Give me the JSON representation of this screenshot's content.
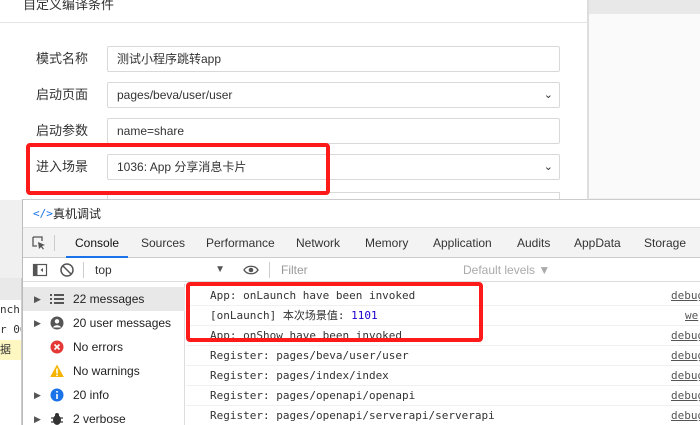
{
  "dialog": {
    "title": "自定义编译条件",
    "fields": [
      {
        "label": "模式名称",
        "value": "测试小程序跳转app",
        "dropdown": false
      },
      {
        "label": "启动页面",
        "value": "pages/beva/user/user",
        "dropdown": true
      },
      {
        "label": "启动参数",
        "value": "name=share",
        "dropdown": false
      },
      {
        "label": "进入场景",
        "value": "1036: App 分享消息卡片",
        "dropdown": true
      }
    ],
    "cut_label": "编",
    "cut_value": ""
  },
  "background": {
    "code_lines": [
      "nch]",
      "r 06",
      "据"
    ]
  },
  "devtools": {
    "title": "真机调试",
    "tabs": [
      "Console",
      "Sources",
      "Performance",
      "Network",
      "Memory",
      "Application",
      "Audits",
      "AppData",
      "Storage"
    ],
    "active_tab": "Console",
    "context": "top",
    "filter_placeholder": "Filter",
    "levels": "Default levels ▼",
    "sidebar": [
      {
        "label": "22 messages",
        "icon": "list-icon",
        "expandable": true,
        "selected": true
      },
      {
        "label": "20 user messages",
        "icon": "user-icon",
        "expandable": true,
        "selected": false
      },
      {
        "label": "No errors",
        "icon": "error-icon",
        "expandable": false,
        "selected": false
      },
      {
        "label": "No warnings",
        "icon": "warning-icon",
        "expandable": false,
        "selected": false
      },
      {
        "label": "20 info",
        "icon": "info-icon",
        "expandable": true,
        "selected": false
      },
      {
        "label": "2 verbose",
        "icon": "verbose-icon",
        "expandable": true,
        "selected": false
      }
    ],
    "logs": [
      {
        "text": "App: onLaunch have been invoked",
        "source": "debug"
      },
      {
        "text": "[onLaunch] 本次场景值:",
        "number": "1101",
        "source": "we"
      },
      {
        "text": "App: onShow have been invoked",
        "source": "debug"
      },
      {
        "text": "Register: pages/beva/user/user",
        "source": "debug"
      },
      {
        "text": "Register: pages/index/index",
        "source": "debug"
      },
      {
        "text": "Register: pages/openapi/openapi",
        "source": "debug"
      },
      {
        "text": "Register: pages/openapi/serverapi/serverapi",
        "source": "debug"
      }
    ]
  },
  "colors": {
    "highlight": "#ff1a1a",
    "accent": "#1a73e8",
    "number": "#1c00cf"
  }
}
